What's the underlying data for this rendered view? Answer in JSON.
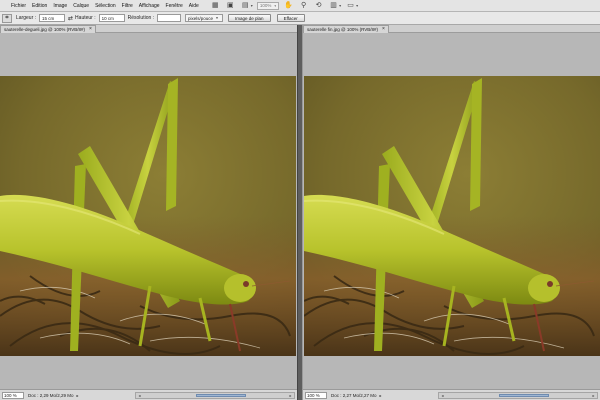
{
  "menubar": {
    "items": [
      "Fichier",
      "Edition",
      "Image",
      "Calque",
      "Sélection",
      "Filtre",
      "Affichage",
      "Fenêtre",
      "Aide"
    ],
    "zoom": "100%",
    "icons": [
      "bridge-icon",
      "mini-bridge-icon",
      "guides-icon",
      "zoom-level-icon",
      "hand-icon",
      "zoom-icon",
      "rotate-view-icon",
      "arrange-icon",
      "screen-mode-icon"
    ]
  },
  "options": {
    "width_label": "Largeur :",
    "width_value": "15 cm",
    "height_label": "Hauteur :",
    "height_value": "10 cm",
    "resolution_label": "Résolution :",
    "resolution_value": "",
    "resolution_unit": "pixels/pouce",
    "front_image_button": "Image de plan",
    "clear_button": "Effacer"
  },
  "documents": [
    {
      "tab_title": "sauterelle-degueli.jpg @ 100% (RVB/8#)",
      "zoom": "100 %",
      "doc_info": "Doc : 2,29 Mo/2,29 Mo"
    },
    {
      "tab_title": "sauterelle fin.jpg @ 100% (RVB/8#)",
      "zoom": "100 %",
      "doc_info": "Doc : 2,27 Mo/2,27 Mo"
    }
  ],
  "colors": {
    "background_olive": "#7d6f2c",
    "grasshopper_green": "#b4c22a",
    "workspace_gray": "#b9b9b9"
  }
}
